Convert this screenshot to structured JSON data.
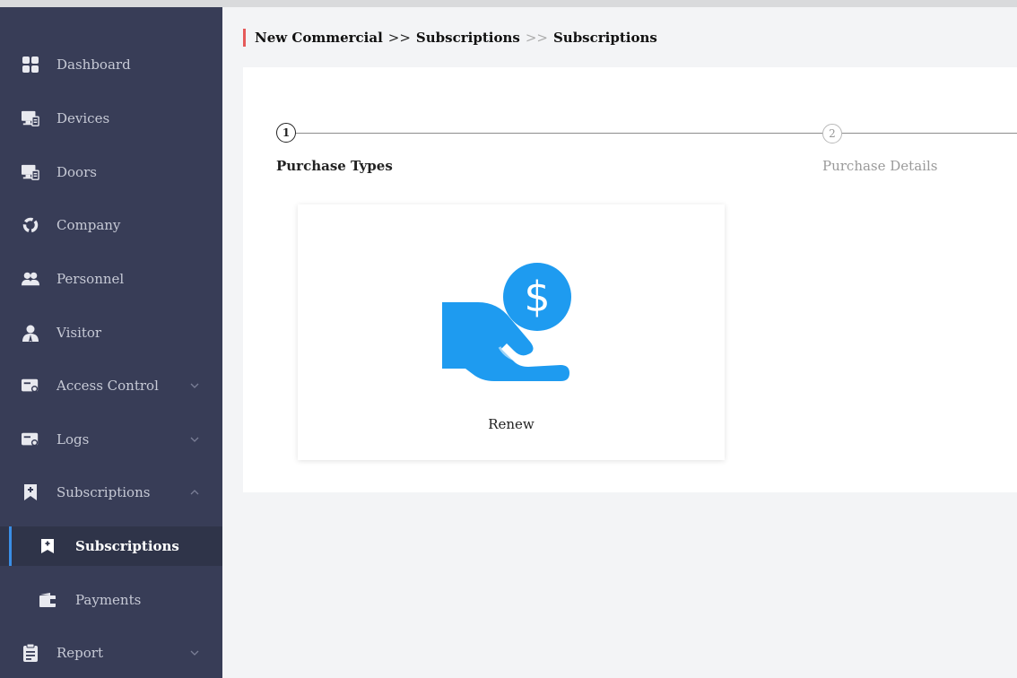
{
  "sidebar": {
    "items": [
      {
        "label": "Dashboard",
        "icon": "dashboard-icon"
      },
      {
        "label": "Devices",
        "icon": "devices-icon"
      },
      {
        "label": "Doors",
        "icon": "doors-icon"
      },
      {
        "label": "Company",
        "icon": "company-icon"
      },
      {
        "label": "Personnel",
        "icon": "personnel-icon"
      },
      {
        "label": "Visitor",
        "icon": "visitor-icon"
      },
      {
        "label": "Access Control",
        "icon": "access-control-icon",
        "expand": "collapsed"
      },
      {
        "label": "Logs",
        "icon": "logs-icon",
        "expand": "collapsed"
      },
      {
        "label": "Subscriptions",
        "icon": "subscriptions-icon",
        "expand": "expanded"
      },
      {
        "label": "Subscriptions",
        "icon": "subscriptions-sub-icon",
        "active": true
      },
      {
        "label": "Payments",
        "icon": "payments-icon"
      },
      {
        "label": "Report",
        "icon": "report-icon",
        "expand": "collapsed"
      }
    ]
  },
  "breadcrumb": {
    "part1": "New Commercial",
    "sep1": ">>",
    "part2": "Subscriptions",
    "sep2": ">>",
    "part3": "Subscriptions"
  },
  "steps": [
    {
      "number": "1",
      "label": "Purchase Types",
      "state": "active"
    },
    {
      "number": "2",
      "label": "Purchase Details",
      "state": "inactive"
    }
  ],
  "card": {
    "label": "Renew",
    "icon": "hand-dollar-icon",
    "symbol": "$"
  },
  "colors": {
    "sidebar_bg": "#383d57",
    "accent": "#3a8ee6",
    "breadcrumb_bar": "#e55a5a",
    "illustration_blue": "#1e9bf0"
  }
}
